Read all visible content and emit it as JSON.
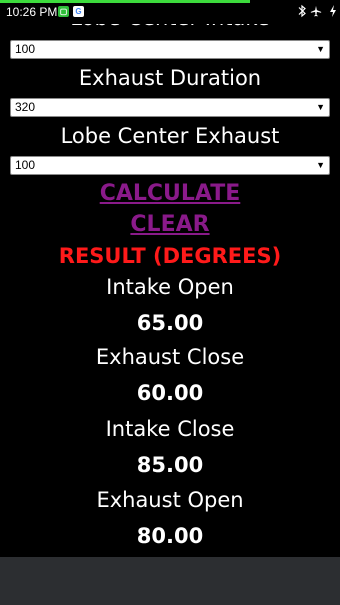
{
  "status_bar": {
    "time": "10:26 PM",
    "notification_icons": [
      "app-notification-icon",
      "google-icon"
    ],
    "system_icons": [
      "bluetooth-icon",
      "airplane-mode-icon",
      "battery-charging-icon"
    ],
    "progress_color": "#3ddc3d"
  },
  "form": {
    "lobe_center_intake": {
      "label": "Lobe Center Intake",
      "value": "100"
    },
    "exhaust_duration": {
      "label": "Exhaust Duration",
      "value": "320"
    },
    "lobe_center_exhaust": {
      "label": "Lobe Center Exhaust",
      "value": "100"
    }
  },
  "actions": {
    "calculate": "CALCULATE",
    "clear": "CLEAR"
  },
  "results": {
    "heading": "RESULT (DEGREES)",
    "intake_open": {
      "label": "Intake Open",
      "value": "65.00"
    },
    "exhaust_close": {
      "label": "Exhaust Close",
      "value": "60.00"
    },
    "intake_close": {
      "label": "Intake Close",
      "value": "85.00"
    },
    "exhaust_open": {
      "label": "Exhaust Open",
      "value": "80.00"
    }
  },
  "colors": {
    "background": "#000000",
    "link": "#8a1a8a",
    "result_heading": "#ff1a1a",
    "bottom_bar": "#2c2e31"
  }
}
